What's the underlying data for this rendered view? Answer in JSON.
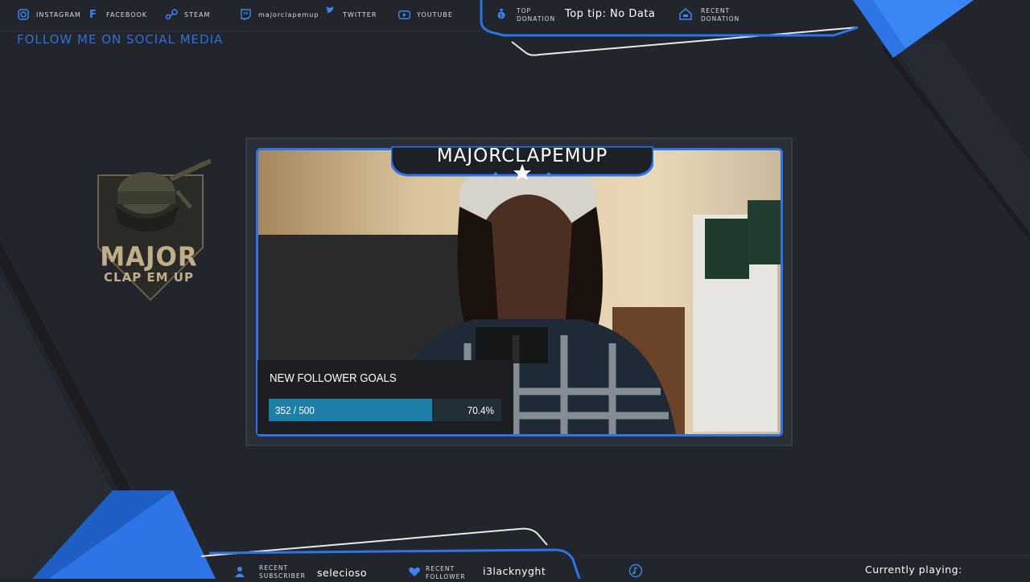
{
  "social": {
    "instagram": "Instagram",
    "facebook": "Facebook",
    "steam": "Steam",
    "twitch": "majorclapemup",
    "twitter": "Twitter",
    "youtube": "Youtube"
  },
  "follow_text": "FOLLOW ME ON SOCIAL MEDIA",
  "top_donation": {
    "label_line1": "Top",
    "label_line2": "Donation",
    "value": "Top tip: No Data"
  },
  "recent_donation": {
    "label_line1": "Recent",
    "label_line2": "Donation"
  },
  "logo": {
    "line1": "MAJOR",
    "line2": "CLAP EM UP"
  },
  "camera": {
    "name": "MAJORCLAPEMUP"
  },
  "goal": {
    "title": "NEW FOLLOWER GOALS",
    "value": "352 / 500",
    "percent": "70.4%",
    "fraction": 0.704
  },
  "recent_subscriber": {
    "label_line1": "Recent",
    "label_line2": "Subscriber",
    "value": "selecioso"
  },
  "recent_follower": {
    "label_line1": "Recent",
    "label_line2": "Follower",
    "value": "i3lacknyght"
  },
  "currently_playing": "Currently playing:",
  "colors": {
    "accent": "#2e74e6",
    "background": "#22252c",
    "logo_gold": "#bfae8a",
    "goal_fill": "#1e7fa8"
  }
}
